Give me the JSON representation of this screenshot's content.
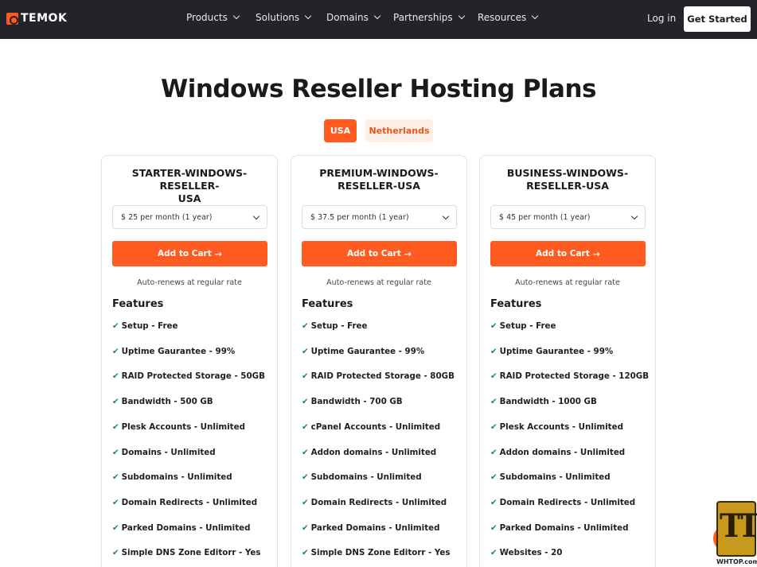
{
  "header": {
    "logo_text": "TEMOK",
    "nav": [
      "Products",
      "Solutions",
      "Domains",
      "Partnerships",
      "Resources"
    ],
    "login": "Log in",
    "cta": "Get Started"
  },
  "page_title": "Windows Reseller Hosting Plans",
  "tabs": [
    {
      "label": "USA",
      "active": true
    },
    {
      "label": "Netherlands",
      "active": false
    }
  ],
  "common": {
    "cart_label": "Add to Cart",
    "renew_text": "Auto-renews at regular rate",
    "features_heading": "Features",
    "check_glyph": "✔"
  },
  "plans": [
    {
      "title_line1": "STARTER-WINDOWS-RESELLER-",
      "title_line2": "USA",
      "price": "$ 25 per month (1 year)",
      "features": [
        "Setup - Free",
        "Uptime Gaurantee - 99%",
        "RAID Protected Storage - 50GB",
        "Bandwidth - 500 GB",
        "Plesk Accounts - Unlimited",
        "Domains - Unlimited",
        "Subdomains - Unlimited",
        "Domain Redirects - Unlimited",
        "Parked Domains - Unlimited",
        "Simple DNS Zone Editorr - Yes"
      ]
    },
    {
      "title_line1": "PREMIUM-WINDOWS-",
      "title_line2": "RESELLER-USA",
      "price": "$ 37.5 per month (1 year)",
      "features": [
        "Setup - Free",
        "Uptime Gaurantee - 99%",
        "RAID Protected Storage - 80GB",
        "Bandwidth - 700 GB",
        "cPanel Accounts - Unlimited",
        "Addon domains - Unlimited",
        "Subdomains - Unlimited",
        "Domain Redirects - Unlimited",
        "Parked Domains - Unlimited",
        "Simple DNS Zone Editorr - Yes"
      ]
    },
    {
      "title_line1": "BUSINESS-WINDOWS-",
      "title_line2": "RESELLER-USA",
      "price": "$ 45 per month (1 year)",
      "features": [
        "Setup - Free",
        "Uptime Gaurantee - 99%",
        "RAID Protected Storage - 120GB",
        "Bandwidth - 1000 GB",
        "Plesk Accounts - Unlimited",
        "Addon domains - Unlimited",
        "Subdomains - Unlimited",
        "Domain Redirects - Unlimited",
        "Parked Domains - Unlimited",
        "Websites - 20"
      ]
    }
  ],
  "watermark": "WHTOP.com",
  "colors": {
    "accent": "#ff5a1f",
    "nav_bg": "#22242a",
    "check": "#1b8a3a"
  }
}
